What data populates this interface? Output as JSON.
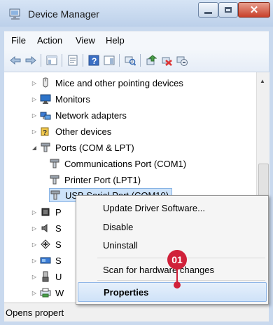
{
  "window": {
    "title": "Device Manager"
  },
  "menubar": {
    "items": [
      "File",
      "Action",
      "View",
      "Help"
    ]
  },
  "tree": {
    "items": [
      {
        "label": "Mice and other pointing devices",
        "icon": "mouse-icon"
      },
      {
        "label": "Monitors",
        "icon": "monitor-icon"
      },
      {
        "label": "Network adapters",
        "icon": "network-icon"
      },
      {
        "label": "Other devices",
        "icon": "unknown-device-icon"
      },
      {
        "label": "Ports (COM & LPT)",
        "icon": "port-icon"
      },
      {
        "label": "Communications Port (COM1)",
        "icon": "port-icon"
      },
      {
        "label": "Printer Port (LPT1)",
        "icon": "port-icon"
      },
      {
        "label": "USB Serial Port (COM10)",
        "icon": "port-icon"
      },
      {
        "label": "P",
        "icon": "processor-icon"
      },
      {
        "label": "S",
        "icon": "sound-icon"
      },
      {
        "label": "S",
        "icon": "storage-icon"
      },
      {
        "label": "S",
        "icon": "system-icon"
      },
      {
        "label": "U",
        "icon": "usb-icon"
      },
      {
        "label": "W",
        "icon": "wsd-icon"
      }
    ]
  },
  "context_menu": {
    "items": [
      "Update Driver Software...",
      "Disable",
      "Uninstall",
      "Scan for hardware changes",
      "Properties"
    ],
    "highlighted": "Properties"
  },
  "callout": {
    "label": "01",
    "color": "#d0213a"
  },
  "status": {
    "text": "Opens propert"
  }
}
